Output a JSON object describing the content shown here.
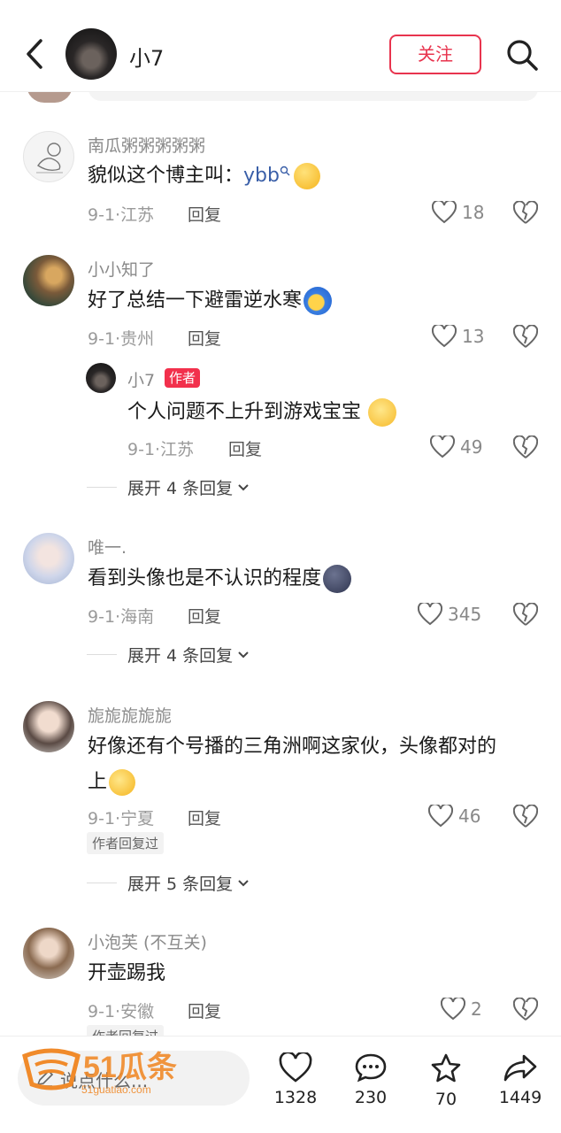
{
  "header": {
    "title": "小7",
    "follow_label": "关注"
  },
  "comments": [
    {
      "username": "南瓜粥粥粥粥粥",
      "text": "貌似这个博主叫：",
      "keyword": "ybb",
      "date": "9-1",
      "location": "江苏",
      "reply_label": "回复",
      "likes": "18"
    },
    {
      "username": "小小知了",
      "text": "好了总结一下避雷逆水寒",
      "date": "9-1",
      "location": "贵州",
      "reply_label": "回复",
      "likes": "13",
      "reply": {
        "username": "小7",
        "badge": "作者",
        "text": "个人问题不上升到游戏宝宝",
        "date": "9-1",
        "location": "江苏",
        "reply_label": "回复",
        "likes": "49"
      },
      "expand_label": "展开 4 条回复"
    },
    {
      "username": "唯一.",
      "text": "看到头像也是不认识的程度",
      "date": "9-1",
      "location": "海南",
      "reply_label": "回复",
      "likes": "345",
      "expand_label": "展开 4 条回复"
    },
    {
      "username": "旎旎旎旎旎",
      "text_line1": "好像还有个号播的三角洲啊这家伙，头像都对的",
      "text_line2": "上",
      "date": "9-1",
      "location": "宁夏",
      "reply_label": "回复",
      "likes": "46",
      "tag": "作者回复过",
      "expand_label": "展开 5 条回复"
    },
    {
      "username": "小泡芙 (不互关)",
      "text": "开壶踢我",
      "date": "9-1",
      "location": "安徽",
      "reply_label": "回复",
      "likes": "2",
      "tag": "作者回复过"
    }
  ],
  "bottom_bar": {
    "input_placeholder": "说点什么...",
    "likes": "1328",
    "comments": "230",
    "favorites": "70",
    "shares": "1449"
  },
  "watermark": {
    "logo_text": "51瓜条",
    "url_text": "51guatiao.com"
  },
  "colors": {
    "accent": "#e8344e",
    "keyword": "#3a5fa8"
  }
}
